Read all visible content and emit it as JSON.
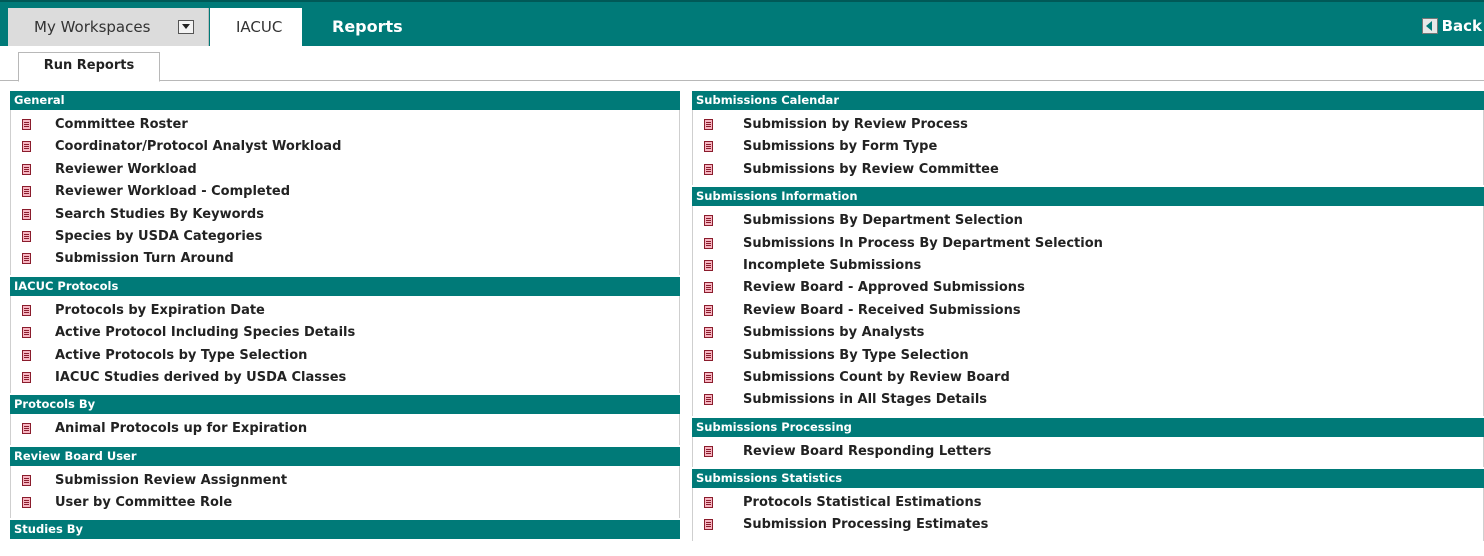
{
  "topbar": {
    "workspaces_label": "My Workspaces",
    "module_tab": "IACUC",
    "reports_tab": "Reports",
    "back_label": "Back"
  },
  "subtabs": {
    "run_reports": "Run Reports"
  },
  "left": [
    {
      "title": "General",
      "items": [
        "Committee Roster",
        "Coordinator/Protocol Analyst Workload",
        "Reviewer Workload",
        "Reviewer Workload - Completed",
        "Search Studies By Keywords",
        "Species by USDA Categories",
        "Submission Turn Around"
      ]
    },
    {
      "title": "IACUC Protocols",
      "items": [
        "Protocols by Expiration Date",
        "Active Protocol Including Species Details",
        "Active Protocols by Type Selection",
        "IACUC Studies derived by USDA Classes"
      ]
    },
    {
      "title": "Protocols By",
      "items": [
        "Animal Protocols up for Expiration"
      ]
    },
    {
      "title": "Review Board User",
      "items": [
        "Submission Review Assignment",
        "User by Committee Role"
      ]
    },
    {
      "title": "Studies By",
      "items": []
    }
  ],
  "right": [
    {
      "title": "Submissions Calendar",
      "items": [
        "Submission by Review Process",
        "Submissions by Form Type",
        "Submissions by Review Committee"
      ]
    },
    {
      "title": "Submissions Information",
      "items": [
        "Submissions By Department Selection",
        "Submissions In Process By Department Selection",
        "Incomplete Submissions",
        "Review Board - Approved Submissions",
        "Review Board - Received Submissions",
        "Submissions by Analysts",
        "Submissions By Type Selection",
        "Submissions Count by Review Board",
        "Submissions in All Stages Details"
      ]
    },
    {
      "title": "Submissions Processing",
      "items": [
        "Review Board Responding Letters"
      ]
    },
    {
      "title": "Submissions Statistics",
      "items": [
        "Protocols Statistical Estimations",
        "Submission Processing Estimates"
      ]
    }
  ],
  "colors": {
    "accent": "#007a78",
    "doc_icon_fill": "#f7b6c2",
    "doc_icon_stroke": "#8a1c2c"
  },
  "icons": {
    "report": "document-icon",
    "back": "back-arrow-icon",
    "dropdown": "chevron-down-icon"
  }
}
